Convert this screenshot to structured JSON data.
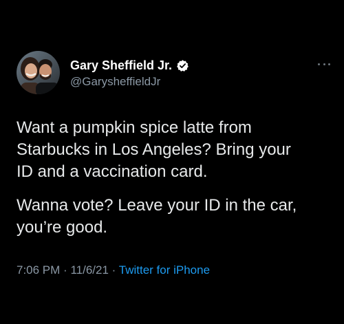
{
  "tweet": {
    "author": {
      "display_name": "Gary Sheffield Jr.",
      "handle": "@GarysheffieldJr",
      "verified": true,
      "avatar_icon": "profile-photo"
    },
    "more_icon": "more-horizontal-icon",
    "paragraphs": [
      "Want a pumpkin spice latte from\nStarbucks in Los Angeles? Bring your\nID and a vaccination card.",
      "Wanna vote? Leave your ID in the car,\nyou’re good."
    ],
    "time": "7:06 PM",
    "date": "11/6/21",
    "separator": "·",
    "source": "Twitter for iPhone"
  },
  "colors": {
    "background": "#000000",
    "text": "#e7e9ea",
    "muted": "#8b98a5",
    "link": "#1d9bf0",
    "verified": "#1d9bf0"
  }
}
